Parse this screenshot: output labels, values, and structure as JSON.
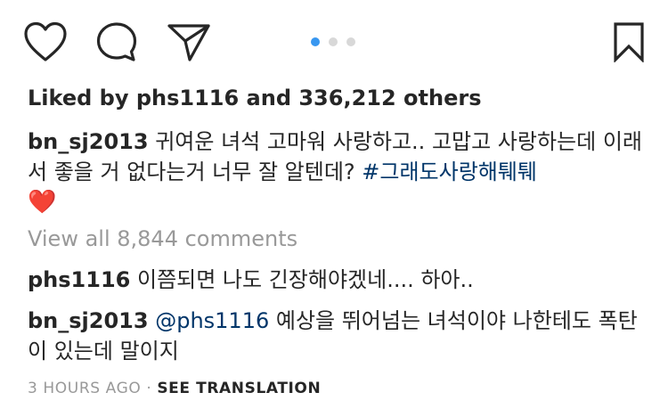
{
  "actions": {
    "like_icon": "heart-outline",
    "comment_icon": "speech-bubble",
    "share_icon": "paper-plane",
    "save_icon": "bookmark-outline"
  },
  "carousel": {
    "count": 3,
    "active_index": 0,
    "active_color": "#3897f0",
    "inactive_color": "#d8d8d8"
  },
  "likes": {
    "prefix": "Liked by ",
    "user": "phs1116",
    "middle": " and ",
    "count": "336,212 others"
  },
  "caption": {
    "username": "bn_sj2013",
    "text": " 귀여운 녀석 고마워 사랑하고.. 고맙고 사랑하는데 이래서 좋을 거 없다는거 너무 잘 알텐데? ",
    "hashtag": "#그래도사랑해퉤퉤",
    "emoji": "❤️"
  },
  "view_all": "View all 8,844 comments",
  "comments": [
    {
      "username": "phs1116",
      "text": " 이쯤되면 나도 긴장해야겠네.... 하아..",
      "mention": ""
    },
    {
      "username": "bn_sj2013",
      "mention": " @phs1116",
      "text": " 예상을 뛰어넘는 녀석이야 나한테도 폭탄이 있는데 말이지"
    }
  ],
  "meta": {
    "time": "3 HOURS AGO",
    "separator": " · ",
    "translate": "SEE TRANSLATION"
  },
  "colors": {
    "link": "#003569",
    "muted": "#999999",
    "text": "#262626",
    "accent": "#3897f0"
  }
}
